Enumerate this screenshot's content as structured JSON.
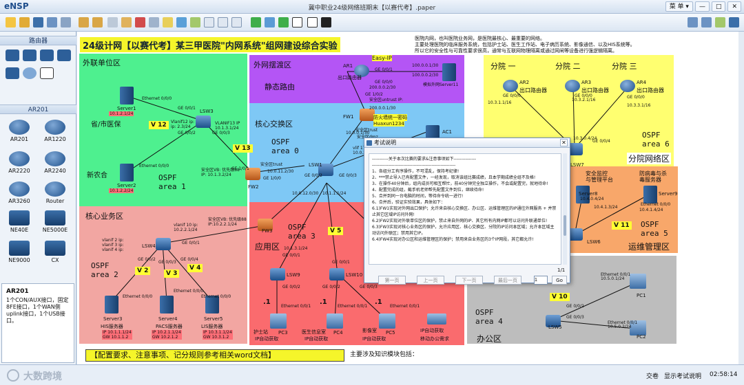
{
  "app": {
    "logo": "eNSP",
    "title": "冀中职业24级网络班期末【以赛代考】.paper"
  },
  "title_controls": {
    "menu": "菜 单 ▾",
    "minimize": "—",
    "maximize": "□",
    "close": "✕"
  },
  "sidebar": {
    "section_router": "路由器",
    "section_ar201": "AR201",
    "devices": [
      "AR201",
      "AR1220",
      "AR2220",
      "AR2240",
      "AR3260",
      "Router",
      "NE40E",
      "NE5000E",
      "NE9000",
      "CX"
    ],
    "info_title": "AR201",
    "info_text": "1个CON/AUX接口，固定8FE接口，1个WAN侧uplink接口，1个USB接口。"
  },
  "status": {
    "watermark": "大数跨境",
    "exam_label": "交卷",
    "show_exam": "显示考试说明",
    "time": "02:58:14"
  },
  "canvas": {
    "title": "24级计网【以赛代考】某三甲医院\"内网系统\"组网建设综合实验",
    "description": "医院内网，也叫医院业务网，是医院最核心、最重要的网络。\n主要处理医院的临床服务系统，包括护士站、医生工作站、电子病历系统、影像通信、以及HIS系统等。\n所以它的安全性与可靠性要求很高，通常与互联网物理隔离或通过网闸等设备进行强逻辑隔离。",
    "zones": {
      "waijie": "外联单位区",
      "waiwang": "外网摆渡区",
      "static": "静态路由",
      "hexin": "核心交换区",
      "yewu": "核心业务区",
      "yingyong": "应用区",
      "bangong": "办公区",
      "fenyuan_net": "分院网络区",
      "yunwei": "运维管理区",
      "fy1": "分院 一",
      "fy2": "分院 二",
      "fy3": "分院 三"
    },
    "area_labels": {
      "sheng": "省/市医保",
      "xinnonghe": "新农合",
      "outlet": "出口路由器",
      "sim": "模拟外网Server11",
      "fw_desc": "防火墙统一密码",
      "fw_pwd": "Huaxun1234"
    },
    "ospf": [
      "OSPF\narea 0",
      "OSPF\narea 1",
      "OSPF\narea 2",
      "OSPF\narea 3",
      "OSPF\narea 4",
      "OSPF\narea 5",
      "OSPF\narea 6"
    ],
    "vlans": [
      "V 12",
      "V 13",
      "V 2",
      "V 3",
      "V 4",
      "V 5",
      "V 10",
      "V 11"
    ],
    "devices": {
      "ar1": "AR1",
      "easyip": "Easy-IP",
      "server1": "Server1",
      "server2": "Server2",
      "lsw3": "LSW3",
      "fw2": "FW2",
      "fw1": "FW1",
      "ac1": "AC1",
      "lsw1": "LSW1",
      "lsw4": "LSW4",
      "fw3": "FW3",
      "lsw9": "LSW9",
      "lsw10": "LSW10",
      "lsw5": "LSW5",
      "lsw6": "LSW6",
      "lsw7": "LSW7",
      "server3": "Server3",
      "server4": "Server4",
      "server5": "Server5",
      "pc1": "PC1",
      "pc2": "PC2",
      "pc3": "PC3",
      "pc4": "PC4",
      "pc5": "PC5",
      "ar2": "AR2",
      "ar3": "AR3",
      "ar4": "AR4",
      "server8": "Server8",
      "server9": "Server9"
    },
    "device_labels": {
      "his": "HIS服务器",
      "pacs": "PACS服务器",
      "lis": "LIS服务器",
      "nurse": "护士站",
      "doctor": "医生信息室",
      "image": "影像室",
      "dhcp1": "IP自动获取",
      "dhcp2": "IP自动获取",
      "dhcp3": "IP自动获取",
      "dhcp4": "IP自动获取",
      "mobile": "移动办公需求",
      "anquan": "安全监控\n与管理平台",
      "jiangbing": "防病毒与杀\n毒服务器",
      "outlet2": "出口路由器",
      "outlet3": "出口路由器",
      "outlet4": "出口路由器"
    },
    "addresses": {
      "a1": "100.0.0.1/30",
      "a2": "100.0.0.2/30",
      "a3": "200.0.0.2/30",
      "a4": "200.0.0.1/30",
      "a5": "10.1.2.1/24",
      "a6": "10.1.2.2/24",
      "a7": "10.1.1.2/24",
      "a8": "10.1.1.1/24",
      "a9": "10.1.3.2/24",
      "a10": "10.0.0.1/30",
      "a11": "10.0.0.2/30",
      "a12": "10.0.11.2/30",
      "a13": "10.0.12.0/30",
      "a14": "10.1.1.1/24",
      "a15": "10.1.2.2/24",
      "a16": "10.1.3.1/24",
      "a17": "10.3.1.1/16",
      "a18": "10.3.2.1/16",
      "a19": "10.3.3.1/16",
      "a20": "10.4.1.3/24",
      "a21": "10.4.1.4/24",
      "a22": "10.5.0.1/24",
      "a23": "10.5.0.2/24",
      "a24": "10.4.0.4/24",
      "a25": "10.3.0.4/24",
      "a26": "IP 10.1.1.1/24\nGW 10.1.1.2",
      "a27": "IP 10.2.1.1/24\nGW 10.2.1.2",
      "a28": "IP 10.3.1.1/24\nGW 10.3.1.2"
    },
    "interfaces": {
      "ge000": "GE 0/0/0",
      "ge001": "GE 0/0/1",
      "ge002": "GE 0/0/2",
      "ge003": "GE 0/0/3",
      "ge004": "GE 0/0/4",
      "ge100": "GE 1/0/0",
      "ge101": "GE 1/0/1",
      "ge102": "GE 1/0/2",
      "ge103": "GE 1/0/3",
      "eth000": "Ethernet 0/0/0",
      "eth001": "Ethernet 0/0/1",
      "fw_trust": "安全区trust",
      "fw_untrust": "安全区untrust IP:",
      "fw_dmz": "安全区dmz",
      "vlanif12": "Vlanif12 ip:\nip: 2.3/24",
      "vlanif13": "VLANIF13 IP\n10.1.3.1/24",
      "fw2_untrust": "安全区VB: 优先级88\nIP: 10.1.3.2/24",
      "fw3_area": "安全区VB: 优先级88\nIP:10.2.2.1/24",
      "vlanif10": "vlanif 10 ip:\n10.2.2.1/24",
      "vlans_lsw4": "vlanif 2 ip:\nvlanif 3 ip:\nvlanif 4 ip:",
      "vlanif17": "vlif 17 ip:\n10.0.2.1/30",
      "dot1": ".1",
      "dot2": ".2"
    },
    "banner": "【配置要求、注意事项、记分规则参考相关word文档】",
    "knowledge_title": "主要涉及知识模块包括："
  },
  "dialog": {
    "title": "考试说明",
    "lines": [
      "-----------关于本次比赛的要求&注意事项如下---------------",
      "--------------------------------------------------------",
      "1、各组分工有序操作，不可混乱，保持考纪律!",
      "2、***禁止导入已有配置文件，一经发现，取消该组比赛成绩，且本学期成绩全组不及格!",
      "3、在操作40分钟后，组内成员可相互帮忙，前40分钟完全独立操作，不会或配置完，就地待命!",
      "4、配置完成的组，截手机老师帮先配置文件到位，继续待命!",
      "5、合并到同一台电脑的时间，等待命令统一进行!",
      "6、合并后，验证实验效果，具体如下：",
      "   6.1)FW1实现对外网出口保护；允许来自核心交换区、办公区、运维管理区的IP通往外网服务 + 并禁止其它区域IP访问外网!",
      "   6.2)FW2实现对外联单位区的保护，禁止来自外网的IP、其它所有内网IP都可以访问外联通单位!",
      "   6.3)FW3实现对核心业务区的保护，允许应用区、核心交换区、分院的IP访问本区域；允许本区域主动访问外联区；禁用其它IP。",
      "   6.4)FW4实现对办公区和运维管理区的保护；禁用来自业务区的3个IP网段，其它都允许!"
    ],
    "page": "1/1",
    "buttons": {
      "first": "第一页",
      "prev": "上一页",
      "next": "下一页",
      "last": "最后一页",
      "go": "Go"
    },
    "page_input": "1"
  },
  "colors": {
    "waijie": "#4ef08f",
    "waiwang": "#b455f5",
    "hexin": "#7ec8f5",
    "yewu": "#f2a6a2",
    "yingyong": "#fa6b6e",
    "bangong": "#bdbdbd",
    "fenyuan": "#ffff70",
    "yunwei": "#f8a76a",
    "title_bg": "#f5f52a"
  }
}
